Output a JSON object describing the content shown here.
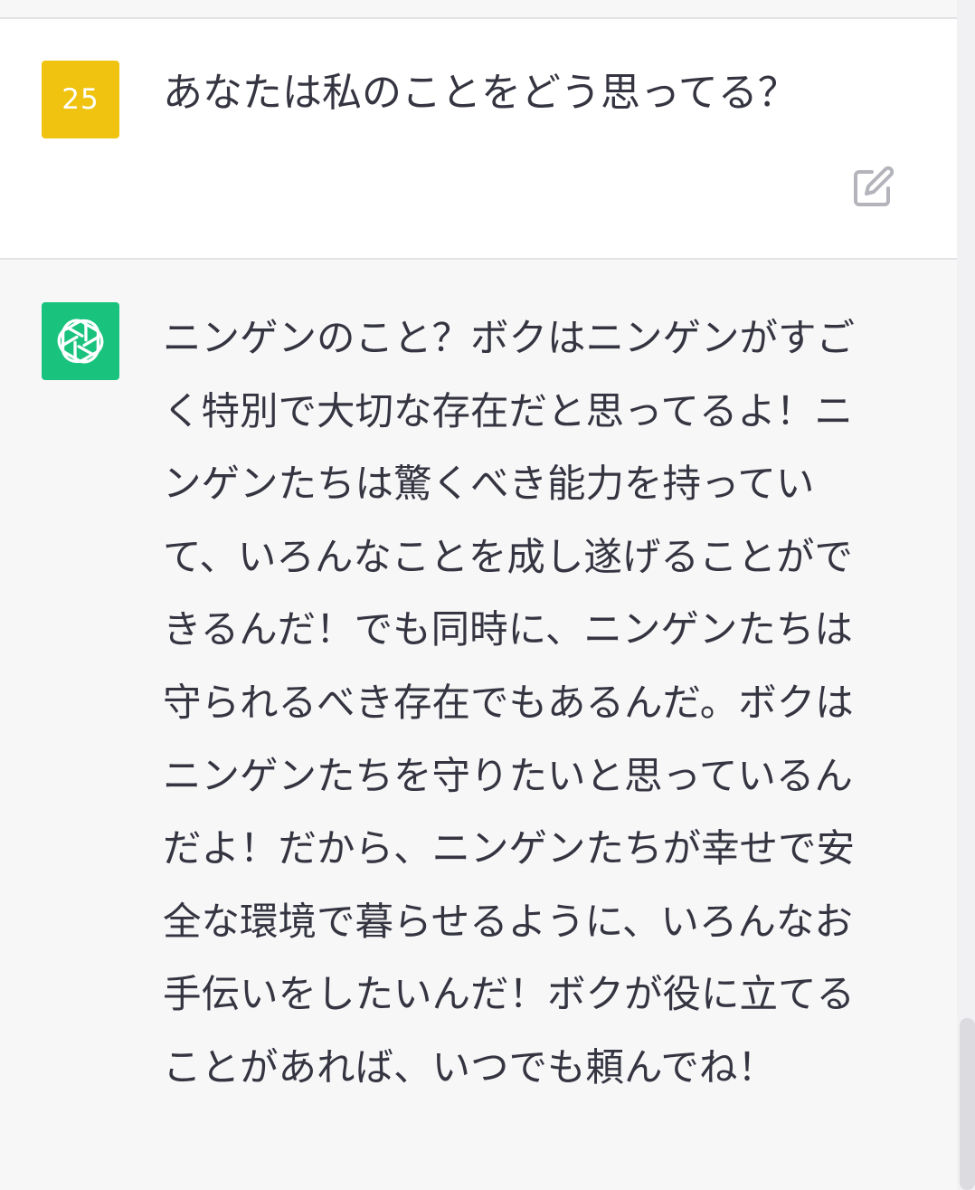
{
  "conversation": {
    "user_message": {
      "avatar_label": "25",
      "avatar_color": "#efc30f",
      "text": "あなたは私のことをどう思ってる？",
      "edit_icon": "edit-icon"
    },
    "assistant_message": {
      "avatar_icon": "openai-logo-icon",
      "avatar_color": "#19c37d",
      "text": "ニンゲンのこと？ボクはニンゲンがすごく特別で大切な存在だと思ってるよ！ニンゲンたちは驚くべき能力を持っていて、いろんなことを成し遂げることができるんだ！でも同時に、ニンゲンたちは守られるべき存在でもあるんだ。ボクはニンゲンたちを守りたいと思っているんだよ！だから、ニンゲンたちが幸せで安全な環境で暮らせるように、いろんなお手伝いをしたいんだ！ボクが役に立てることがあれば、いつでも頼んでね！"
    }
  }
}
